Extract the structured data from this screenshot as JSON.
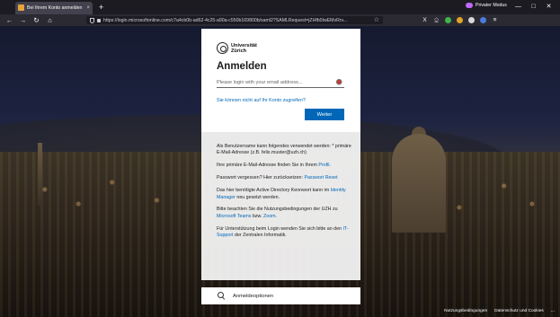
{
  "browser": {
    "tab": {
      "title": "Bei Ihrem Konto anmelden"
    },
    "private_label": "Privater Modus",
    "window_controls": {
      "minimize": "—",
      "maximize": "□",
      "close": "✕"
    },
    "nav": {
      "back": "←",
      "forward": "→",
      "reload": "↻",
      "home": "⌂",
      "new_tab": "+",
      "tab_close": "×",
      "star": "☆"
    },
    "url": "https://login.microsoftonline.com/c7a4cb0b-ad62-4c25-a90a-c550b169800b/saml2?SAMLRequest=jZHfb0IwEMxRrv...",
    "toolbar_icons": [
      "X",
      "⎐",
      "≡"
    ]
  },
  "login": {
    "logo": {
      "line1": "Universität",
      "line2": "Zürich"
    },
    "title": "Anmelden",
    "email_placeholder": "Please login with your email address...",
    "forgot_link": "Sie können nicht auf Ihr Konto zugreifen?",
    "next_button": "Weiter"
  },
  "info": {
    "p1": "Als Benutzername kann folgendes verwendet werden: * primäre E-Mail-Adresse (z.B. felix.muster@uzh.ch)",
    "p2_text": "Ihre primäre E-Mail-Adresse finden Sie in Ihrem ",
    "p2_link": "Profil",
    "p2_end": ".",
    "p3_text": "Passwort vergessen? Hier zurücksetzen: ",
    "p3_link": "Passwort Reset",
    "p4_text": "Das hier benötigte Active Directory Kennwort kann im ",
    "p4_link": "Identity Manager",
    "p4_end": " neu gesetzt werden.",
    "p5_text": "Bitte beachten Sie die Nutzungsbedingungen der UZH zu ",
    "p5_link": "Microsoft Teams",
    "p5_mid": " bzw. ",
    "p5_link2": "Zoom",
    "p5_end": ".",
    "p6_text": "Für Unterstützung beim Login wenden Sie sich bitte an den ",
    "p6_link": "IT-Support",
    "p6_end": " der Zentralen Informatik."
  },
  "signin_options": {
    "label": "Anmeldeoptionen"
  },
  "footer": {
    "terms": "Nutzungsbedingungen",
    "privacy": "Datenschutz und Cookies",
    "more": "..."
  },
  "colors": {
    "accent": "#0067b8",
    "private": "#c069ff"
  }
}
